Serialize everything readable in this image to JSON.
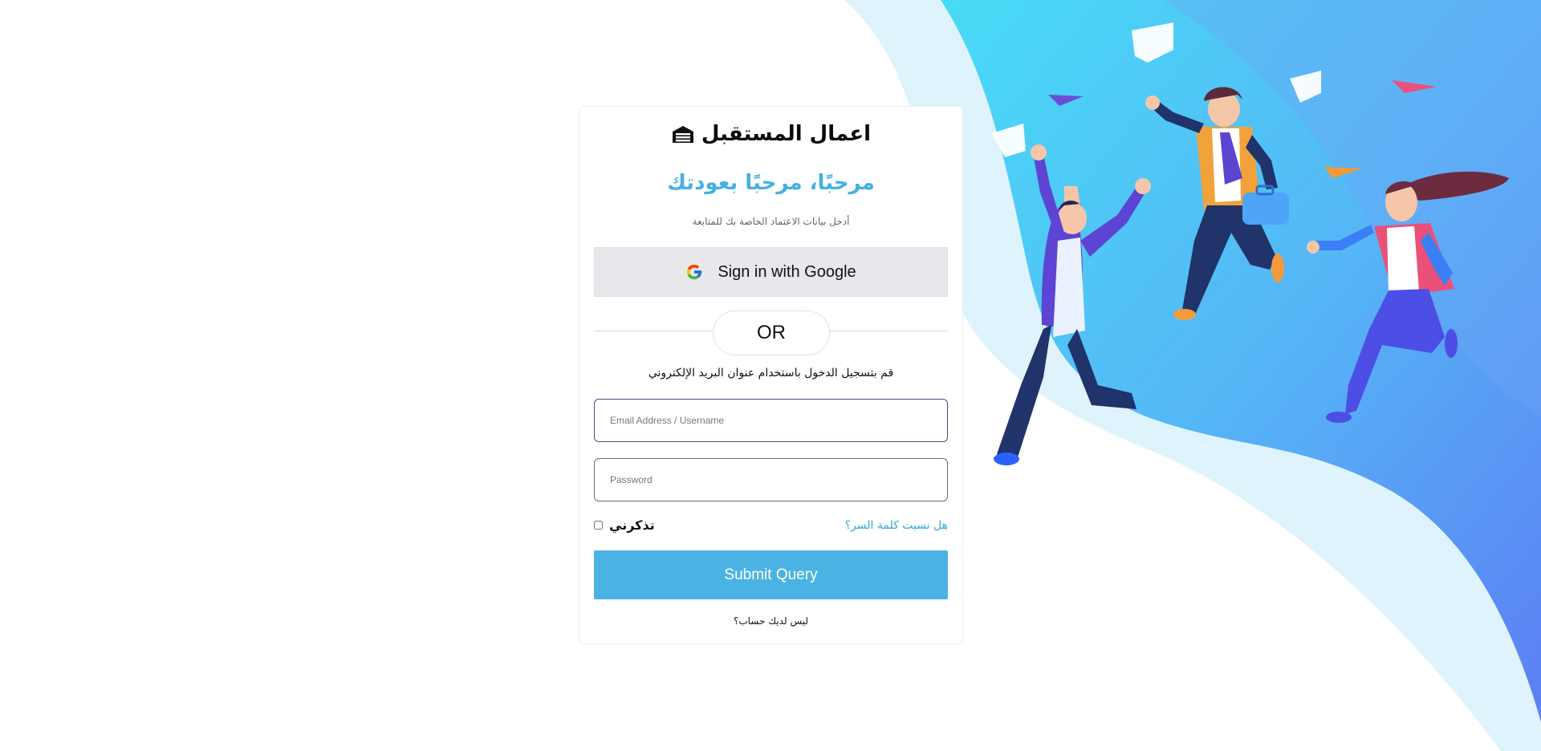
{
  "brand": {
    "name": "اعمال المستقبل",
    "icon": "garage-icon"
  },
  "login": {
    "welcome": "مرحبًا، مرحبًا بعودتك",
    "subtitle": "أدخل بيانات الاعتماد الخاصة بك للمتابعة",
    "google_label": "Sign in with Google",
    "or_label": "OR",
    "email_section_title": "قم بتسجيل الدخول باستخدام عنوان البريد الإلكتروني",
    "email_placeholder": "Email Address / Username",
    "email_value": "",
    "password_placeholder": "Password",
    "password_value": "",
    "remember_label": "تذكرني",
    "remember_checked": false,
    "forgot_label": "هل نسيت كلمة السر؟",
    "submit_label": "Submit Query",
    "no_account": "ليس لديك حساب؟"
  },
  "colors": {
    "accent": "#46b0e2",
    "submit_bg": "#4bb3e4",
    "google_bg": "#e7e7ec",
    "hero_light": "#dff3fc",
    "hero_cyan": "#45d6f5",
    "hero_blue": "#5a86f5"
  },
  "hero": {
    "illustration": "jumping-business-people-illustration"
  }
}
